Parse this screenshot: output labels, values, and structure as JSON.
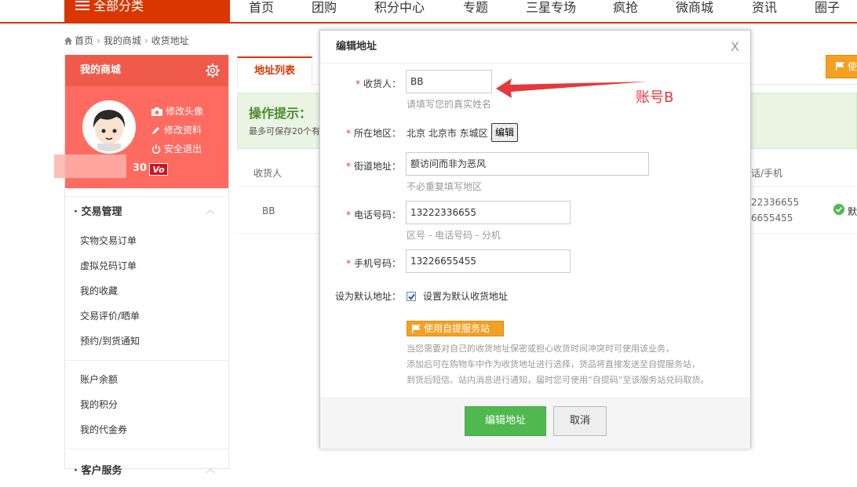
{
  "topnav": {
    "all_categories": "全部分类",
    "links": [
      "首页",
      "团购",
      "积分中心",
      "专题",
      "三星专场",
      "疯抢",
      "微商城",
      "资讯",
      "圈子"
    ]
  },
  "breadcrumb": {
    "home": "首页",
    "level2": "我的商城",
    "level3": "收货地址"
  },
  "sidebar": {
    "header": "我的商城",
    "profile": {
      "change_avatar": "修改头像",
      "edit_profile": "修改资料",
      "logout": "安全退出",
      "username_suffix": "30",
      "vip_badge": "Vo"
    },
    "sections": [
      {
        "title": "交易管理",
        "items": [
          "实物交易订单",
          "虚拟兑码订单",
          "我的收藏",
          "交易评价/晒单",
          "预约/到货通知"
        ]
      },
      {
        "title": "",
        "items": [
          "账户余额",
          "我的积分",
          "我的代金券"
        ]
      },
      {
        "title": "客户服务",
        "items": []
      }
    ]
  },
  "main": {
    "tab_active": "地址列表",
    "new_button": "使",
    "tips": {
      "title": "操作提示：",
      "text": "最多可保存20个有"
    },
    "table": {
      "col_receiver": "收货人",
      "col_phone": "话/手机",
      "rows": [
        {
          "receiver": "BB",
          "phone1": "22336655",
          "phone2": "6655455",
          "default_label": "默"
        }
      ]
    }
  },
  "modal": {
    "title": "编辑地址",
    "close": "X",
    "fields": {
      "receiver": {
        "label": "收货人：",
        "value": "BB",
        "hint": "请填写您的真实姓名"
      },
      "region": {
        "label": "所在地区：",
        "value": "北京 北京市 东城区",
        "edit_btn": "编辑"
      },
      "street": {
        "label": "街道地址：",
        "value": "额访问而非为恶风",
        "hint": "不必重复填写地区"
      },
      "phone": {
        "label": "电话号码：",
        "value": "13222336655",
        "hint": "区号 - 电话号码 - 分机"
      },
      "mobile": {
        "label": "手机号码：",
        "value": "13226655455"
      },
      "default": {
        "label": "设为默认地址：",
        "checkbox_text": "设置为默认收货地址"
      }
    },
    "self_pickup_button": "使用自提服务站",
    "description": [
      "当您需要对自己的收货地址保密或担心收货时间冲突时可使用该业务，",
      "添加后可在购物车中作为收货地址进行选择，货品将直接发送至自提服务站，",
      "到货后短信、站内消息进行通知，届时您可使用“自提码”至该服务站兑码取货。"
    ],
    "submit_button": "编辑地址",
    "cancel_button": "取消"
  },
  "annotation": {
    "text": "账号B",
    "color": "#e4393c"
  },
  "colors": {
    "brand": "#d93600",
    "sidebar_head": "#f05a4a",
    "profile_bg": "#ff6b60",
    "tips_bg": "#e9f4e3",
    "success": "#4fb84f",
    "orange": "#f4a024"
  }
}
